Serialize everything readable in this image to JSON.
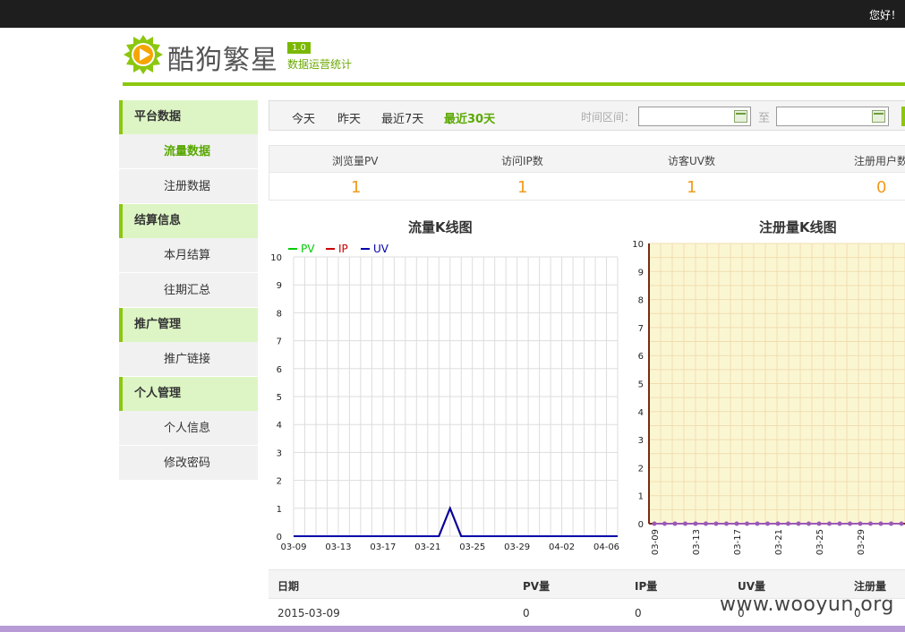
{
  "topbar": {
    "greeting": "您好！"
  },
  "logo": {
    "brand": "酷狗繁星",
    "version": "1.0",
    "subtitle": "数据运营统计"
  },
  "sidebar": [
    {
      "group": "平台数据",
      "items": [
        {
          "label": "流量数据",
          "active": true
        },
        {
          "label": "注册数据",
          "active": false
        }
      ]
    },
    {
      "group": "结算信息",
      "items": [
        {
          "label": "本月结算",
          "active": false
        },
        {
          "label": "往期汇总",
          "active": false
        }
      ]
    },
    {
      "group": "推广管理",
      "items": [
        {
          "label": "推广链接",
          "active": false
        }
      ]
    },
    {
      "group": "个人管理",
      "items": [
        {
          "label": "个人信息",
          "active": false
        },
        {
          "label": "修改密码",
          "active": false
        }
      ]
    }
  ],
  "toolbar": {
    "tabs": [
      "今天",
      "昨天",
      "最近7天",
      "最近30天"
    ],
    "active_tab": "最近30天",
    "range_label": "时间区间：",
    "start_date": "",
    "to_label": "至",
    "end_date": ""
  },
  "stats": {
    "labels": [
      "浏览量PV",
      "访问IP数",
      "访客UV数",
      "注册用户数"
    ],
    "values": [
      "1",
      "1",
      "1",
      "0"
    ]
  },
  "charts": {
    "traffic_title": "流量K线图",
    "register_title": "注册量K线图"
  },
  "chart_data": [
    {
      "type": "line",
      "title": "流量K线图",
      "x": [
        "03-09",
        "03-10",
        "03-11",
        "03-12",
        "03-13",
        "03-14",
        "03-15",
        "03-16",
        "03-17",
        "03-18",
        "03-19",
        "03-20",
        "03-21",
        "03-22",
        "03-23",
        "03-24",
        "03-25",
        "03-26",
        "03-27",
        "03-28",
        "03-29",
        "03-30",
        "03-31",
        "04-01",
        "04-02",
        "04-03",
        "04-04",
        "04-05",
        "04-06",
        "04-07"
      ],
      "x_tick_labels": [
        "03-09",
        "03-13",
        "03-17",
        "03-21",
        "03-25",
        "03-29",
        "04-02",
        "04-06"
      ],
      "series": [
        {
          "name": "PV",
          "color": "#00cc00",
          "values": [
            0,
            0,
            0,
            0,
            0,
            0,
            0,
            0,
            0,
            0,
            0,
            0,
            0,
            0,
            1,
            0,
            0,
            0,
            0,
            0,
            0,
            0,
            0,
            0,
            0,
            0,
            0,
            0,
            0,
            0
          ]
        },
        {
          "name": "IP",
          "color": "#cc0000",
          "values": [
            0,
            0,
            0,
            0,
            0,
            0,
            0,
            0,
            0,
            0,
            0,
            0,
            0,
            0,
            1,
            0,
            0,
            0,
            0,
            0,
            0,
            0,
            0,
            0,
            0,
            0,
            0,
            0,
            0,
            0
          ]
        },
        {
          "name": "UV",
          "color": "#0000aa",
          "values": [
            0,
            0,
            0,
            0,
            0,
            0,
            0,
            0,
            0,
            0,
            0,
            0,
            0,
            0,
            1,
            0,
            0,
            0,
            0,
            0,
            0,
            0,
            0,
            0,
            0,
            0,
            0,
            0,
            0,
            0
          ]
        }
      ],
      "ylim": [
        0,
        10
      ],
      "y_ticks": [
        0,
        1,
        2,
        3,
        4,
        5,
        6,
        7,
        8,
        9,
        10
      ],
      "grid": true,
      "legend": "top-left"
    },
    {
      "type": "line",
      "title": "注册量K线图",
      "x": [
        "03-09",
        "03-10",
        "03-11",
        "03-12",
        "03-13",
        "03-14",
        "03-15",
        "03-16",
        "03-17",
        "03-18",
        "03-19",
        "03-20",
        "03-21",
        "03-22",
        "03-23",
        "03-24",
        "03-25",
        "03-26",
        "03-27",
        "03-28",
        "03-29",
        "03-30",
        "03-31",
        "04-01",
        "04-02"
      ],
      "x_tick_labels": [
        "03-09",
        "03-13",
        "03-17",
        "03-21",
        "03-25",
        "03-29"
      ],
      "series": [
        {
          "color": "#9b59b6",
          "values": [
            0,
            0,
            0,
            0,
            0,
            0,
            0,
            0,
            0,
            0,
            0,
            0,
            0,
            0,
            0,
            0,
            0,
            0,
            0,
            0,
            0,
            0,
            0,
            0,
            0
          ]
        }
      ],
      "ylim": [
        0,
        10
      ],
      "y_ticks": [
        0,
        1,
        2,
        3,
        4,
        5,
        6,
        7,
        8,
        9,
        10
      ],
      "grid": true,
      "background": "#fbf6d2"
    }
  ],
  "table": {
    "headers": [
      "日期",
      "PV量",
      "IP量",
      "UV量",
      "注册量"
    ],
    "rows": [
      [
        "2015-03-09",
        "0",
        "0",
        "0",
        "0"
      ]
    ]
  },
  "watermark": "www.wooyun.org"
}
